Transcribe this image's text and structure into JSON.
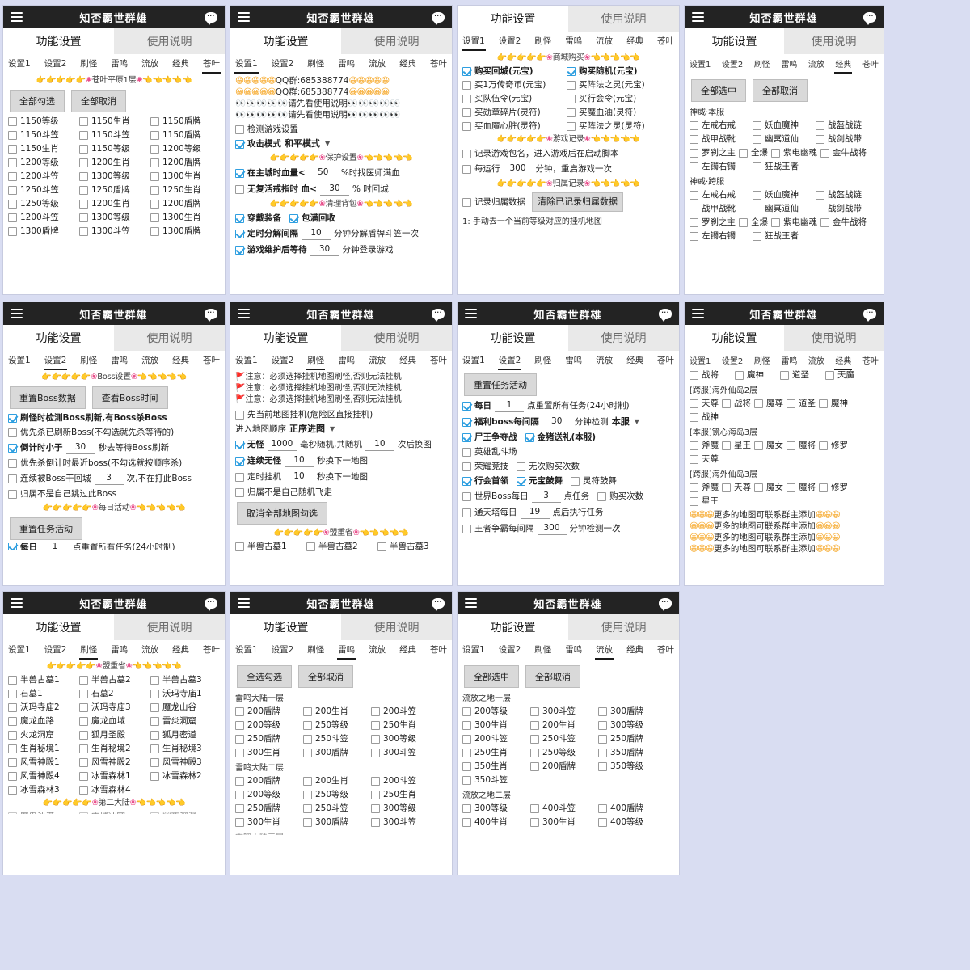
{
  "app": {
    "title": "知否霸世群雄",
    "hamburger_icon": "hamburger-menu-icon",
    "chat_icon": "chat-bubble-icon",
    "bubble_dots": "···"
  },
  "tabs": {
    "settings": "功能设置",
    "instructions": "使用说明"
  },
  "subtabs": [
    "设置1",
    "设置2",
    "刷怪",
    "雷鸣",
    "流放",
    "经典",
    "苍叶"
  ],
  "buttons": {
    "check_all": "全部勾选",
    "uncheck_all": "全部取消",
    "select_all": "全部选中",
    "select_all2": "全选勾选",
    "reset_boss": "重置Boss数据",
    "view_boss_time": "查看Boss时间",
    "reset_task": "重置任务活动",
    "clear_owner_data": "清除已记录归属数据",
    "cancel_all_maps": "取消全部地图勾选"
  },
  "panels": [
    {
      "id": "p1",
      "active_subtab": "苍叶",
      "banner": "苍叶平原1层",
      "rows": [
        [
          "1150等级",
          "1150生肖",
          "1150盾牌"
        ],
        [
          "1150斗笠",
          "1150斗笠",
          "1150盾牌"
        ],
        [
          "1150生肖",
          "1150等级",
          "1200等级"
        ],
        [
          "1200等级",
          "1200生肖",
          "1200盾牌"
        ],
        [
          "1200斗笠",
          "1300等级",
          "1300生肖"
        ],
        [
          "1250斗笠",
          "1250盾牌",
          "1250生肖"
        ],
        [
          "1250等级",
          "1200生肖",
          "1200盾牌"
        ],
        [
          "1200斗笠",
          "1300等级",
          "1300生肖"
        ],
        [
          "1300盾牌",
          "1300斗笠",
          "1300盾牌"
        ]
      ]
    },
    {
      "id": "p2",
      "active_subtab": "设置1",
      "qq_line": "QQ群:685388774",
      "read_line": "请先看使用说明",
      "detect_game": "检测游戏设置",
      "attack_mode": "攻击模式",
      "attack_mode_value": "和平模式",
      "banner_protect": "保护设置",
      "hp_pre": "在主城时血量<",
      "hp_value": "50",
      "hp_post": "%时找医师满血",
      "ring_pre": "无复活戒指时 血<",
      "ring_value": "30",
      "ring_post": "% 时回城",
      "banner_bag": "清理背包",
      "wear_equip": "穿戴装备",
      "bag_full_recycle": "包满回收",
      "decomp_pre": "定时分解间隔",
      "decomp_value": "10",
      "decomp_post": "分钟分解盾牌斗笠一次",
      "maint_pre": "游戏维护后等待",
      "maint_value": "30",
      "maint_post": "分钟登录游戏"
    },
    {
      "id": "p3",
      "active_subtab": "设置1",
      "banner_shop": "商城购买",
      "shop_rows": [
        [
          "购买回城(元宝)",
          "购买随机(元宝)"
        ],
        [
          "买1万传奇币(元宝)",
          "买阵法之灵(元宝)"
        ],
        [
          "买队伍令(元宝)",
          "买行会令(元宝)"
        ],
        [
          "买勋章碎片(灵符)",
          "买魔血油(灵符)"
        ],
        [
          "买血魔心脏(灵符)",
          "买阵法之灵(灵符)"
        ]
      ],
      "banner_record": "游戏记录",
      "record_pkg": "记录游戏包名，进入游戏后在启动脚本",
      "run_pre": "每运行",
      "run_value": "300",
      "run_post": "分钟，重启游戏一次",
      "banner_owner": "归属记录",
      "record_owner": "记录归属数据",
      "footer": "1: 手动去一个当前等级对应的挂机地图"
    },
    {
      "id": "p4",
      "active_subtab": "经典",
      "group1": "神威·本服",
      "group2": "神威·跨服",
      "rows3": [
        [
          "左戒右戒",
          "妖血魔神",
          "战盔战链"
        ],
        [
          "战甲战靴",
          "幽冥道仙",
          "战剑战带"
        ]
      ],
      "rows4": [
        "罗刹之主",
        "全爆",
        "紫电幽魂",
        "金牛战将"
      ],
      "rows2": [
        "左镯右镯",
        "狂战王者"
      ]
    },
    {
      "id": "p5",
      "active_subtab": "设置2",
      "banner_boss": "Boss设置",
      "items": [
        {
          "label": "刷怪时检测Boss刷新,有Boss杀Boss",
          "checked": true
        },
        {
          "label": "优先杀已刷新Boss(不勾选就先杀等待的)",
          "checked": false
        }
      ],
      "count_pre": "倒计时小于",
      "count_value": "30",
      "count_post": "秒去等待Boss刷新",
      "prio": "优先杀倒计时最近boss(不勾选就按顺序杀)",
      "dead_pre": "连续被Boss干回城",
      "dead_value": "3",
      "dead_post": "次,不在打此Boss",
      "skip": "归属不是自己跳过此Boss",
      "banner_daily": "每日活动",
      "daily_pre": "每日",
      "daily_value": "1",
      "daily_post": "点重置所有任务(24小时制)"
    },
    {
      "id": "p6",
      "active_subtab": "刷怪",
      "warning": "注意：必须选择挂机地图刷怪,否则无法挂机",
      "first_map": "先当前地图挂机(危险区直接挂机)",
      "order_label": "进入地图顺序",
      "order_value": "正序进图",
      "nomob_pre": "无怪",
      "nomob_v1": "1000",
      "nomob_mid": "毫秒随机,共随机",
      "nomob_v2": "10",
      "nomob_post": "次后换图",
      "cont_pre": "连续无怪",
      "cont_value": "10",
      "cont_post": "秒换下一地图",
      "timer_pre": "定时挂机",
      "timer_value": "10",
      "timer_post": "秒换下一地图",
      "owner_fly": "归属不是自己随机飞走",
      "banner_meng": "盟重省",
      "maps": [
        "半兽古墓1",
        "半兽古墓2",
        "半兽古墓3"
      ]
    },
    {
      "id": "p7",
      "active_subtab": "设置2",
      "daily_pre": "每日",
      "daily_value": "1",
      "daily_post": "点重置所有任务(24小时制)",
      "boss_pre": "福利boss每间隔",
      "boss_value": "30",
      "boss_mid": "分钟检测",
      "boss_sel": "本服",
      "king": "尸王争夺战",
      "pig": "金猪送礼(本服)",
      "hero": "英雄乱斗场",
      "glory": "荣耀竞技",
      "glory2": "无次购买次数",
      "guild": "行会首领",
      "yuanbao": "元宝鼓舞",
      "lingfu": "灵符鼓舞",
      "wb_pre": "世界Boss每日",
      "wb_value": "3",
      "wb_post": "点任务",
      "wb_buy": "购买次数",
      "tower_pre": "通天塔每日",
      "tower_value": "19",
      "tower_post": "点后执行任务",
      "wang_pre": "王者争霸每间隔",
      "wang_value": "300",
      "wang_post": "分钟检测一次"
    },
    {
      "id": "p8",
      "active_subtab": "经典",
      "top_row": [
        "战将",
        "魔神",
        "道圣",
        "天魔"
      ],
      "groups": [
        {
          "name": "[跨服]海外仙岛2层",
          "rows": [
            [
              "天尊",
              "战将",
              "魔尊",
              "道圣",
              "魔神"
            ],
            [
              "战神"
            ]
          ]
        },
        {
          "name": "[本服]镜心海岛3层",
          "rows": [
            [
              "斧魔",
              "星王",
              "魔女",
              "魔将",
              "修罗"
            ],
            [
              "天尊"
            ]
          ]
        },
        {
          "name": "[跨服]海外仙岛3层",
          "rows": [
            [
              "斧魔",
              "天尊",
              "魔女",
              "魔将",
              "修罗"
            ],
            [
              "星王"
            ]
          ]
        }
      ],
      "footer_line": "更多的地图可联系群主添加"
    },
    {
      "id": "p9",
      "active_subtab": "刷怪",
      "banner_meng": "盟重省",
      "rows": [
        [
          "半兽古墓1",
          "半兽古墓2",
          "半兽古墓3"
        ],
        [
          "石墓1",
          "石墓2",
          "沃玛寺庙1"
        ],
        [
          "沃玛寺庙2",
          "沃玛寺庙3",
          "魔龙山谷"
        ],
        [
          "魔龙血路",
          "魔龙血域",
          "雷炎洞窟"
        ],
        [
          "火龙洞窟",
          "狐月圣殿",
          "狐月密道"
        ],
        [
          "生肖秘境1",
          "生肖秘境2",
          "生肖秘境3"
        ],
        [
          "风雪神殿1",
          "风雪神殿2",
          "风雪神殿3"
        ],
        [
          "风雪神殿4",
          "冰雪森林1",
          "冰雪森林2"
        ],
        [
          "冰雪森林3",
          "冰雪森林4"
        ]
      ],
      "banner2": "第二大陆",
      "cut_row": [
        "魔鬼沙漠",
        "雪域冰寒",
        "幽夜深渊"
      ]
    },
    {
      "id": "p10",
      "active_subtab": "雷鸣",
      "groups": [
        {
          "name": "雷鸣大陆一层",
          "rows": [
            [
              "200盾牌",
              "200生肖",
              "200斗笠"
            ],
            [
              "200等级",
              "250等级",
              "250生肖"
            ],
            [
              "250盾牌",
              "250斗笠",
              "300等级"
            ],
            [
              "300生肖",
              "300盾牌",
              "300斗笠"
            ]
          ]
        },
        {
          "name": "雷鸣大陆二层",
          "rows": [
            [
              "200盾牌",
              "200生肖",
              "200斗笠"
            ],
            [
              "200等级",
              "250等级",
              "250生肖"
            ],
            [
              "250盾牌",
              "250斗笠",
              "300等级"
            ],
            [
              "300生肖",
              "300盾牌",
              "300斗笠"
            ]
          ]
        }
      ],
      "cut_name": "雷鸣大陆三层"
    },
    {
      "id": "p11",
      "active_subtab": "流放",
      "groups": [
        {
          "name": "流放之地一层",
          "rows": [
            [
              "200等级",
              "300斗笠",
              "300盾牌"
            ],
            [
              "300生肖",
              "200生肖",
              "300等级"
            ],
            [
              "200斗笠",
              "250斗笠",
              "250盾牌"
            ],
            [
              "250生肖",
              "250等级",
              "350盾牌"
            ],
            [
              "350生肖",
              "200盾牌",
              "350等级"
            ],
            [
              "350斗笠"
            ]
          ]
        },
        {
          "name": "流放之地二层",
          "rows": [
            [
              "300等级",
              "400斗笠",
              "400盾牌"
            ],
            [
              "400生肖",
              "300生肖",
              "400等级"
            ]
          ]
        }
      ]
    }
  ],
  "colors": {
    "titlebar": "#232323",
    "accent_check": "#2f9fe0",
    "banner_yellow": "#f0b429",
    "banner_pink": "#e84d8a",
    "page_bg": "#d9ddf2",
    "button_bg": "#d9d9d9"
  }
}
